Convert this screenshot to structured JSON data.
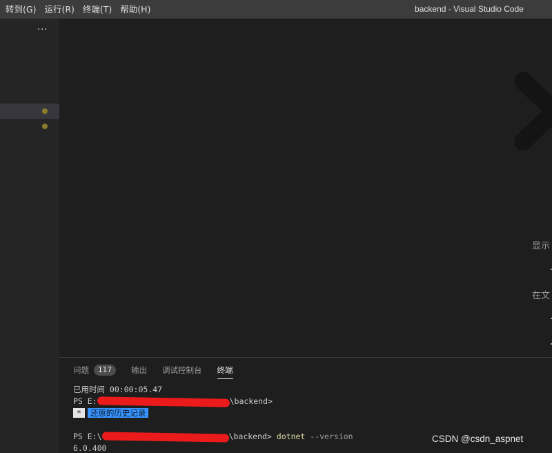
{
  "menu": {
    "goto": "转到(G)",
    "run": "运行(R)",
    "terminal": "终端(T)",
    "help": "帮助(H)"
  },
  "window_title": "backend - Visual Studio Code",
  "sidebar": {
    "more": "···"
  },
  "editor": {
    "hint_show": "显示",
    "hint_in_file": "在文"
  },
  "panel": {
    "tabs": {
      "problems": "问题",
      "problems_count": "117",
      "output": "输出",
      "debug_console": "调试控制台",
      "terminal": "终端"
    }
  },
  "terminal": {
    "elapsed": "已用时间 00:00:05.47",
    "prompt1_prefix": "PS E:",
    "prompt1_suffix": "\\backend>",
    "restore_star": "*",
    "restore_text": "还原的历史记录",
    "prompt2_prefix": "PS E:\\",
    "prompt2_suffix": "\\backend>",
    "command": "dotnet",
    "command_arg": "--version",
    "output": "6.0.400"
  },
  "watermark_text": "CSDN @csdn_aspnet",
  "colors": {
    "accent": "#3794ff",
    "redaction": "#ec1b1b",
    "modified_dot": "#8d7b2c"
  }
}
